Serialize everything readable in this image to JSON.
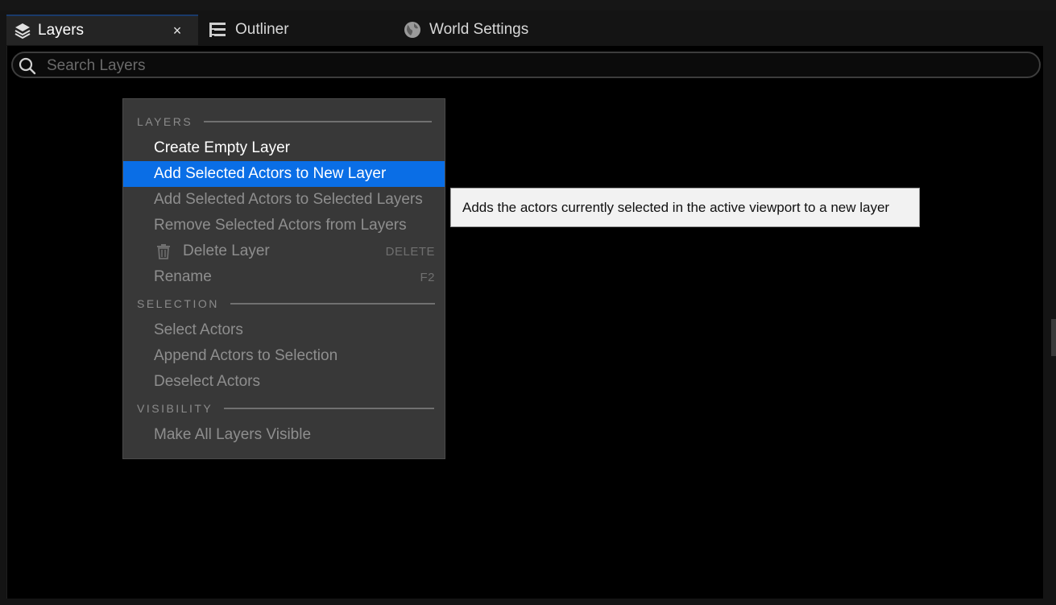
{
  "tabs": [
    {
      "label": "Layers",
      "icon": "layers-icon",
      "active": true,
      "close": "×"
    },
    {
      "label": "Outliner",
      "icon": "outliner-icon"
    },
    {
      "label": "World Settings",
      "icon": "globe-icon"
    }
  ],
  "search": {
    "placeholder": "Search Layers",
    "value": ""
  },
  "context_menu": {
    "sections": {
      "layers": "LAYERS",
      "selection": "SELECTION",
      "visibility": "VISIBILITY"
    },
    "items": {
      "create_empty_layer": "Create Empty Layer",
      "add_to_new_layer": "Add Selected Actors to New Layer",
      "add_to_selected_layers": "Add Selected Actors to Selected Layers",
      "remove_from_layers": "Remove Selected Actors from Layers",
      "delete_layer": "Delete Layer",
      "delete_shortcut": "DELETE",
      "rename": "Rename",
      "rename_shortcut": "F2",
      "select_actors": "Select Actors",
      "append_actors": "Append Actors to Selection",
      "deselect_actors": "Deselect Actors",
      "make_all_visible": "Make All Layers Visible"
    },
    "highlighted": "add_to_new_layer"
  },
  "tooltip": {
    "text": "Adds the actors currently selected in the active viewport to a new layer"
  },
  "colors": {
    "highlight": "#0a6ee6",
    "menu_bg": "#383838",
    "tooltip_bg": "#f2f2f2"
  }
}
